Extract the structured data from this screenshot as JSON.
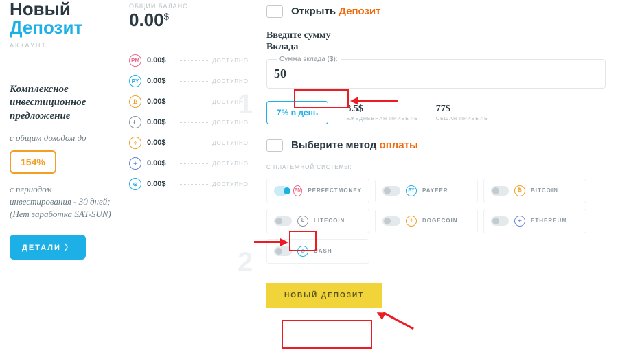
{
  "left": {
    "title1": "Новый",
    "title2": "Депозит",
    "subtitle": "АККАУНТ",
    "offer": "Комплексное инвестиционное предложение",
    "income": "с общим доходом до",
    "percent": "154%",
    "note": "с периодом инвестирования - 30 дней; (Нет заработка SAT-SUN)",
    "details_btn": "ДЕТАЛИ  〉"
  },
  "mid": {
    "balance_lbl": "ОБЩИЙ БАЛАНС",
    "balance": "0.00",
    "currency": "$",
    "available": "ДОСТУПНО",
    "wallets": [
      {
        "sym": "PM",
        "color": "#e86a8a",
        "amt": "0.00$"
      },
      {
        "sym": "PY",
        "color": "#1db0e6",
        "amt": "0.00$"
      },
      {
        "sym": "₿",
        "color": "#f0a024",
        "amt": "0.00$"
      },
      {
        "sym": "Ł",
        "color": "#8a969d",
        "amt": "0.00$"
      },
      {
        "sym": "◊",
        "color": "#f0a024",
        "amt": "0.00$"
      },
      {
        "sym": "✦",
        "color": "#6a87d6",
        "amt": "0.00$"
      },
      {
        "sym": "⊝",
        "color": "#1db0e6",
        "amt": "0.00$"
      }
    ]
  },
  "right": {
    "open1": "Открыть ",
    "open2": "Депозит",
    "enter_amount": "Введите сумму Вклада",
    "field_legend": "Сумма вклада ($):",
    "amount_value": "50",
    "rate": "7% в день",
    "daily_val": "3.5$",
    "daily_lbl": "ЕЖЕДНЕВНАЯ ПРИБЫЛЬ",
    "total_val": "77$",
    "total_lbl": "ОБЩАЯ ПРИБЫЛЬ",
    "choose1": "Выберите метод ",
    "choose2": "оплаты",
    "system_lbl": "С ПЛАТЕЖНОЙ СИСТЕМЫ:",
    "methods": [
      {
        "sym": "PM",
        "color": "#e86a8a",
        "name": "PERFECTMONEY",
        "on": true
      },
      {
        "sym": "PY",
        "color": "#1db0e6",
        "name": "PAYEER",
        "on": false
      },
      {
        "sym": "₿",
        "color": "#f0a024",
        "name": "BITCOIN",
        "on": false
      },
      {
        "sym": "Ł",
        "color": "#8a969d",
        "name": "LITECOIN",
        "on": false
      },
      {
        "sym": "◊",
        "color": "#f0a024",
        "name": "DOGECOIN",
        "on": false
      },
      {
        "sym": "✦",
        "color": "#6a87d6",
        "name": "ETHEREUM",
        "on": false
      },
      {
        "sym": "⊝",
        "color": "#1db0e6",
        "name": "DASH",
        "on": false
      }
    ],
    "submit": "НОВЫЙ ДЕПОЗИТ"
  }
}
